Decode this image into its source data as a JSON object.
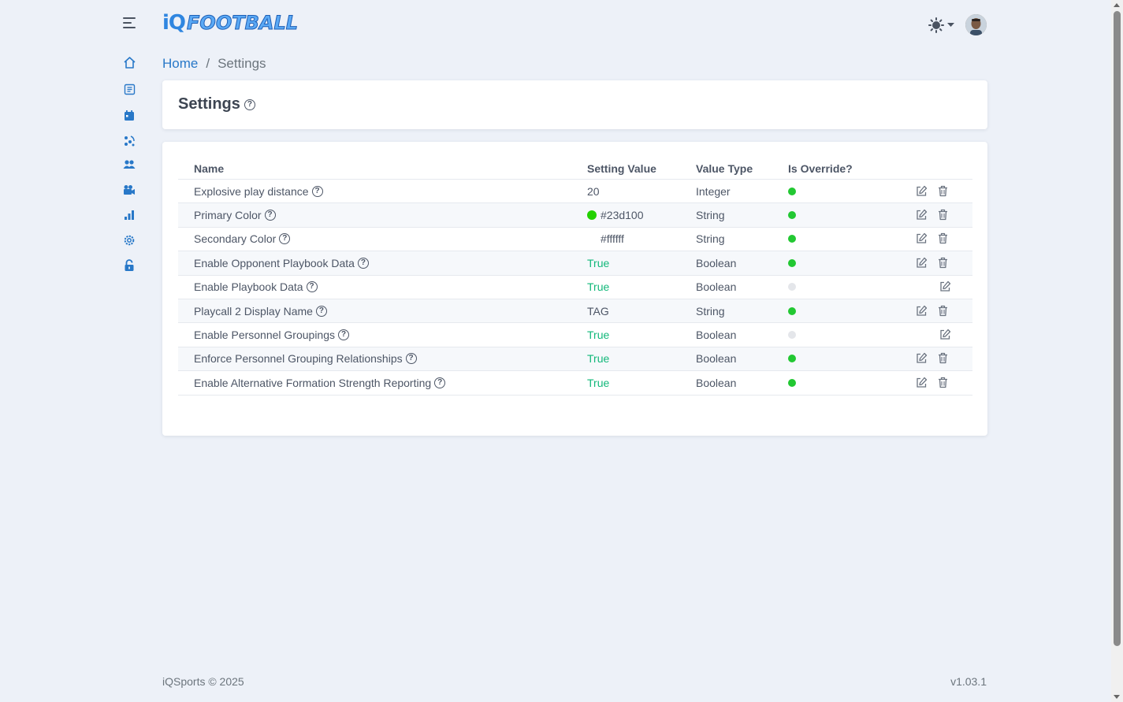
{
  "header": {
    "logo_iq": "iQ",
    "logo_football": "FOOTBALL"
  },
  "breadcrumb": {
    "home": "Home",
    "separator": "/",
    "current": "Settings"
  },
  "page": {
    "title": "Settings",
    "help": "?"
  },
  "table": {
    "columns": [
      "Name",
      "Setting Value",
      "Value Type",
      "Is Override?"
    ],
    "rows": [
      {
        "name": "Explosive play distance",
        "value": "20",
        "type": "Integer",
        "override": true,
        "deletable": true
      },
      {
        "name": "Primary Color",
        "value": "#23d100",
        "type": "String",
        "override": true,
        "deletable": true,
        "swatch": "#23d100"
      },
      {
        "name": "Secondary Color",
        "value": "#ffffff",
        "type": "String",
        "override": true,
        "deletable": true,
        "swatch": "#ffffff"
      },
      {
        "name": "Enable Opponent Playbook Data",
        "value": "True",
        "type": "Boolean",
        "override": true,
        "deletable": true
      },
      {
        "name": "Enable Playbook Data",
        "value": "True",
        "type": "Boolean",
        "override": false,
        "deletable": false
      },
      {
        "name": "Playcall 2 Display Name",
        "value": "TAG",
        "type": "String",
        "override": true,
        "deletable": true
      },
      {
        "name": "Enable Personnel Groupings",
        "value": "True",
        "type": "Boolean",
        "override": false,
        "deletable": false
      },
      {
        "name": "Enforce Personnel Grouping Relationships",
        "value": "True",
        "type": "Boolean",
        "override": true,
        "deletable": true
      },
      {
        "name": "Enable Alternative Formation Strength Reporting",
        "value": "True",
        "type": "Boolean",
        "override": true,
        "deletable": true
      }
    ]
  },
  "footer": {
    "copyright": "iQSports © 2025",
    "version": "v1.03.1"
  },
  "colors": {
    "accent": "#2878c8",
    "true_value": "#12b87a",
    "override_on": "#22c832",
    "override_off": "#e4e6ea"
  },
  "icons": [
    "menu-icon",
    "home-icon",
    "playbook-icon",
    "calendar-icon",
    "formation-icon",
    "users-icon",
    "video-icon",
    "chart-icon",
    "settings-icon",
    "unlock-icon",
    "theme-sun-icon",
    "chevron-down-icon",
    "edit-icon",
    "trash-icon",
    "help-icon"
  ]
}
